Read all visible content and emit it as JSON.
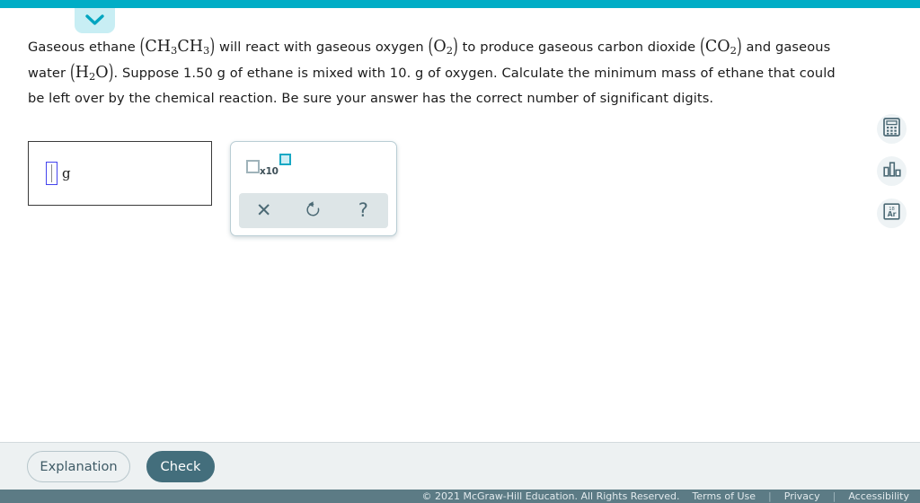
{
  "topbar": {
    "color": "#00adc6",
    "tab_color": "#c8eef4",
    "tab_icon": "chevron-down-icon"
  },
  "question": {
    "segments": [
      {
        "type": "text",
        "value": "Gaseous ethane "
      },
      {
        "type": "formula",
        "value": "CH3CH3"
      },
      {
        "type": "text",
        "value": " will react with gaseous oxygen "
      },
      {
        "type": "formula",
        "value": "O2"
      },
      {
        "type": "text",
        "value": " to produce gaseous carbon dioxide "
      },
      {
        "type": "formula",
        "value": "CO2"
      },
      {
        "type": "text",
        "value": " and gaseous water "
      },
      {
        "type": "formula",
        "value": "H2O"
      },
      {
        "type": "text",
        "value": ". Suppose 1.50 g of ethane is mixed with 10. g of oxygen. Calculate the minimum mass of ethane that could be left over by the chemical reaction. Be sure your answer has the correct number of significant digits."
      }
    ],
    "t1": "Gaseous ethane ",
    "t2": " will react with gaseous oxygen ",
    "t3": " to produce gaseous carbon dioxide ",
    "t4": " and gaseous water ",
    "t5": ". Suppose 1.50 g of ethane is mixed with 10. g of oxygen. Calculate the minimum mass of ethane that could be left over by the chemical reaction. Be sure your answer has the correct number of significant digits.",
    "f_ethane_a": "CH",
    "f_ethane_a_sub": "3",
    "f_ethane_b": "CH",
    "f_ethane_b_sub": "3",
    "f_oxygen": "O",
    "f_oxygen_sub": "2",
    "f_co2": "CO",
    "f_co2_sub": "2",
    "f_water_h": "H",
    "f_water_h_sub": "2",
    "f_water_o": "O",
    "paren_open": "(",
    "paren_close": ")"
  },
  "answer": {
    "value": "",
    "placeholder": "",
    "unit": "g",
    "cursor_color": "#4444ee"
  },
  "keypad": {
    "sci_notation_label": "x10",
    "sci_notation_name": "scientific-notation-button",
    "clear_label": "✕",
    "undo_label": "↺",
    "help_label": "?",
    "accent_color": "#17a8c4"
  },
  "rail": {
    "items": [
      {
        "name": "calculator-icon",
        "label": "Calculator"
      },
      {
        "name": "bar-chart-icon",
        "label": "Data"
      },
      {
        "name": "periodic-table-icon",
        "label": "Periodic Table"
      }
    ],
    "periodic_number": "18",
    "periodic_symbol": "Ar"
  },
  "actions": {
    "explanation_label": "Explanation",
    "check_label": "Check",
    "check_bg": "#436e7c"
  },
  "footer": {
    "copyright": "© 2021 McGraw-Hill Education. All Rights Reserved.",
    "terms": "Terms of Use",
    "privacy": "Privacy",
    "accessibility": "Accessibility",
    "separator": "|",
    "bg": "#5c7b85"
  }
}
